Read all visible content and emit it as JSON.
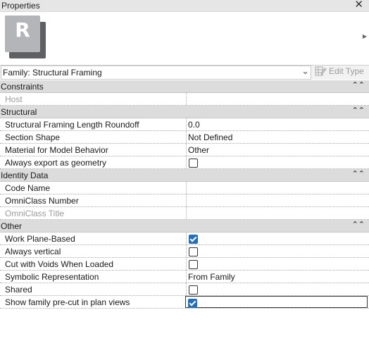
{
  "window": {
    "title": "Properties"
  },
  "preview": {
    "logo_letter": "R"
  },
  "type_selector": {
    "value": "Family: Structural Framing",
    "edit_type_label": "Edit Type"
  },
  "groups": {
    "constraints": {
      "label": "Constraints",
      "host": {
        "name": "Host",
        "value": ""
      }
    },
    "structural": {
      "label": "Structural",
      "length_roundoff": {
        "name": "Structural Framing Length Roundoff",
        "value": "0.0"
      },
      "section_shape": {
        "name": "Section Shape",
        "value": "Not Defined"
      },
      "material_behavior": {
        "name": "Material for Model Behavior",
        "value": "Other"
      },
      "export_geometry": {
        "name": "Always export as geometry",
        "checked": false
      }
    },
    "identity": {
      "label": "Identity Data",
      "code_name": {
        "name": "Code Name",
        "value": ""
      },
      "omniclass_number": {
        "name": "OmniClass Number",
        "value": ""
      },
      "omniclass_title": {
        "name": "OmniClass Title",
        "value": ""
      }
    },
    "other": {
      "label": "Other",
      "work_plane_based": {
        "name": "Work Plane-Based",
        "checked": true
      },
      "always_vertical": {
        "name": "Always vertical",
        "checked": false
      },
      "cut_voids": {
        "name": "Cut with Voids When Loaded",
        "checked": false
      },
      "symbolic_rep": {
        "name": "Symbolic Representation",
        "value": "From Family"
      },
      "shared": {
        "name": "Shared",
        "checked": false
      },
      "precut": {
        "name": "Show family pre-cut in plan views",
        "checked": true
      }
    }
  },
  "colors": {
    "accent": "#1f6fc5",
    "group_header": "#dcdcdc",
    "titlebar": "#e6e6e6"
  }
}
